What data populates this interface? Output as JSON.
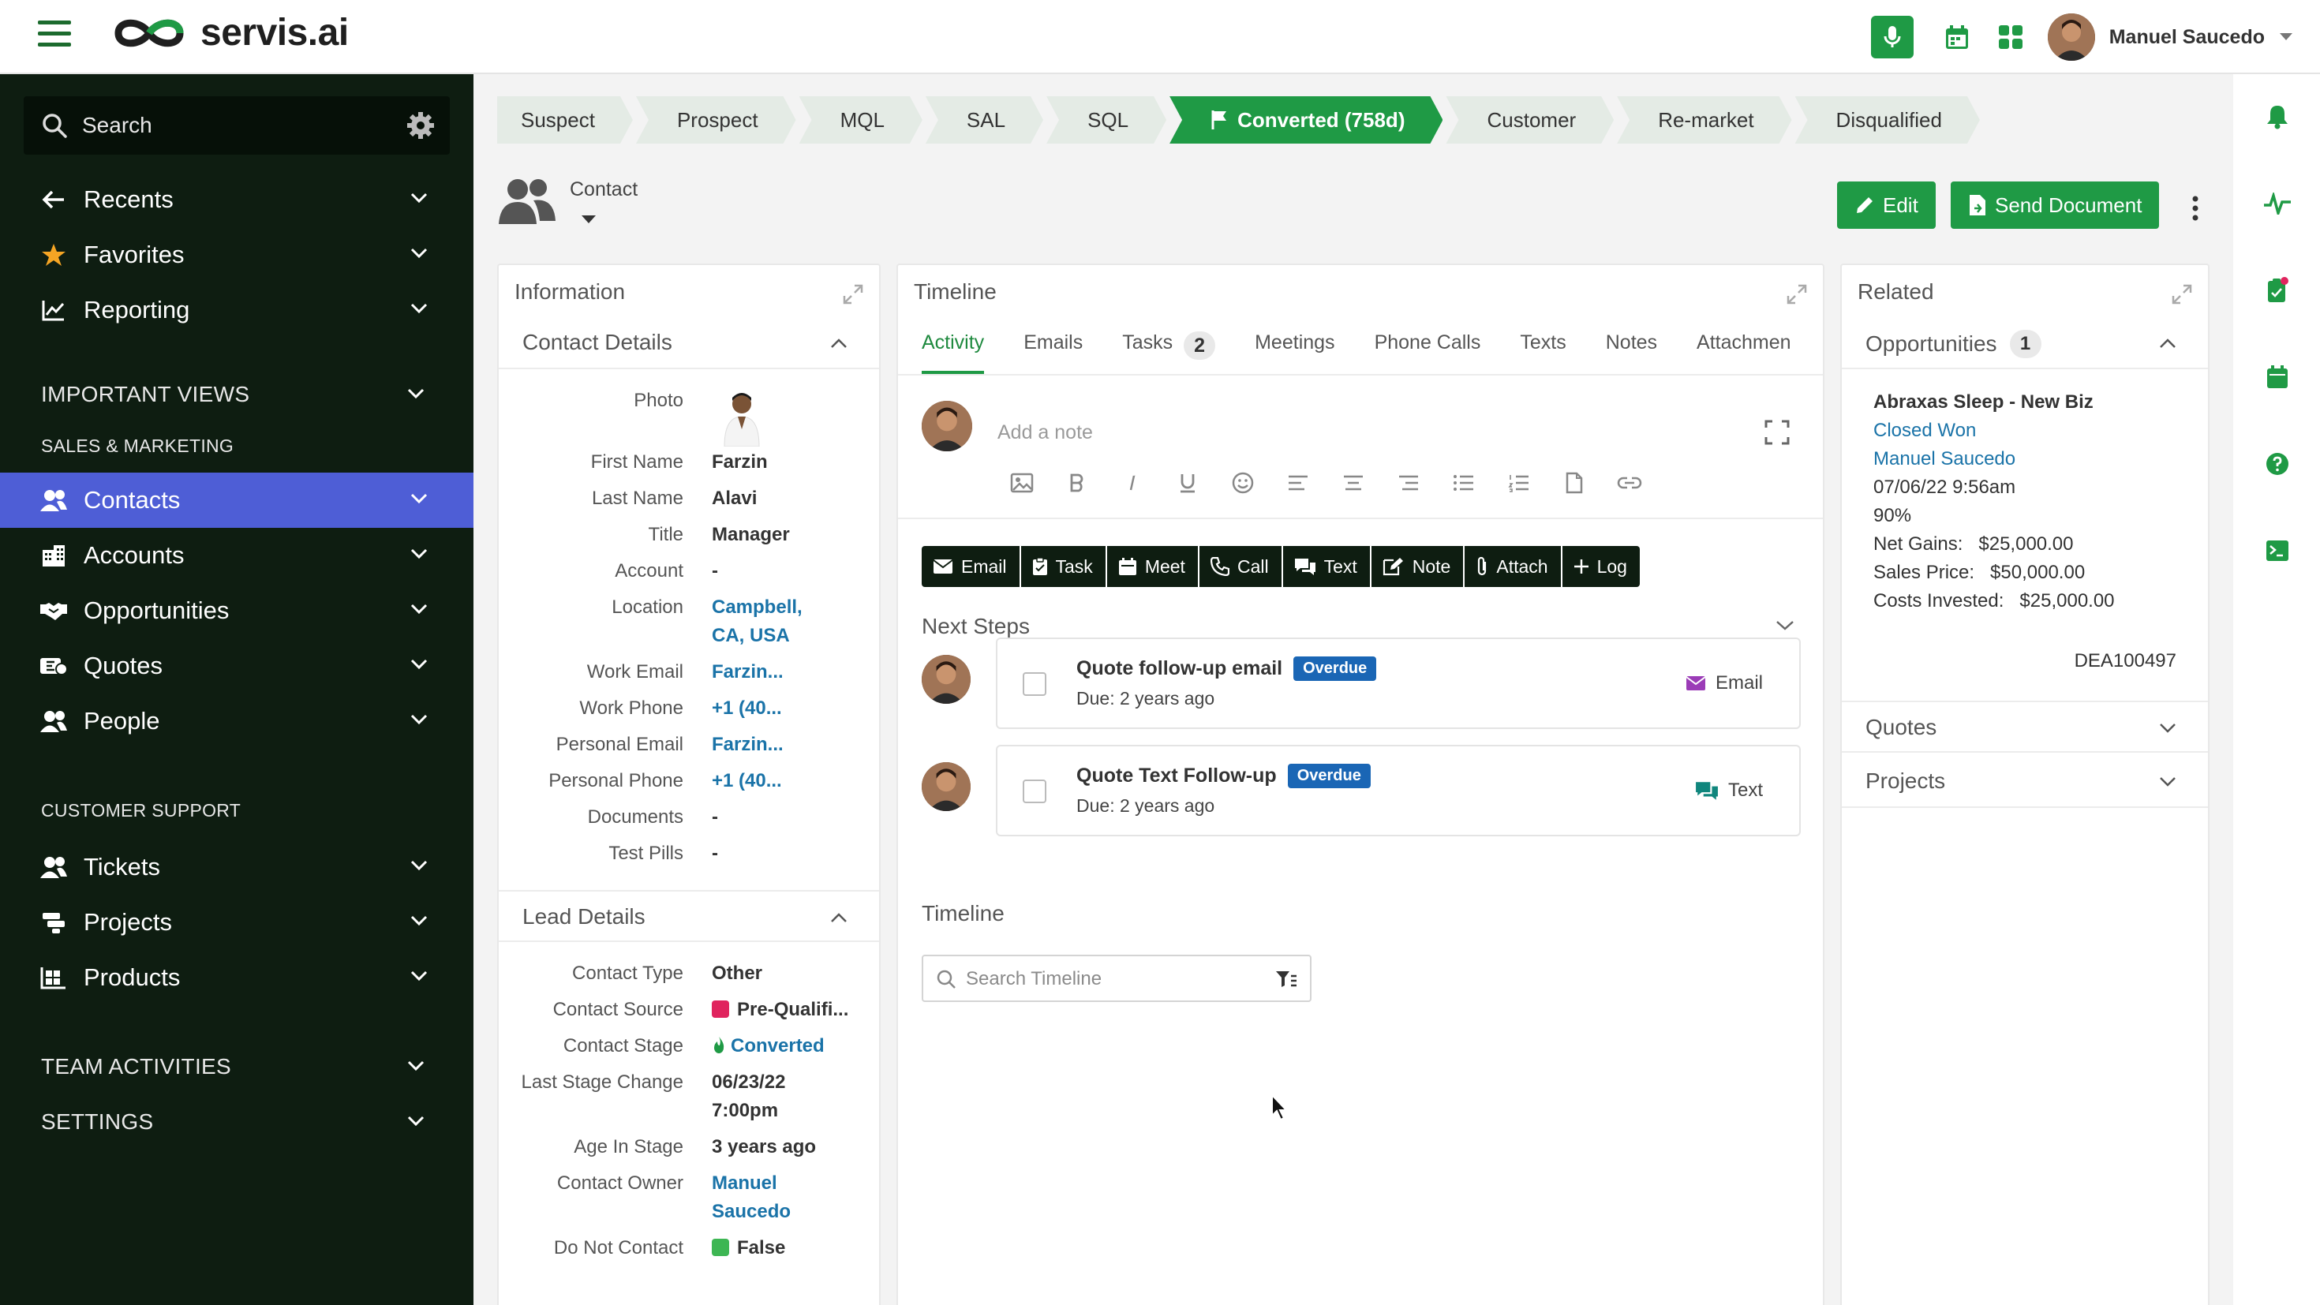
{
  "app": {
    "logo_text": "servis.ai",
    "user_name": "Manuel Saucedo"
  },
  "colors": {
    "brand_green": "#1f9a45",
    "sidebar_bg": "#0e1d11",
    "active_item": "#4e5ed6",
    "link": "#1a73a8",
    "overdue_badge": "#1a66b5"
  },
  "sidebar": {
    "search_label": "Search",
    "items": [
      {
        "label": "Recents",
        "icon": "arrow-left-icon"
      },
      {
        "label": "Favorites",
        "icon": "star-icon"
      },
      {
        "label": "Reporting",
        "icon": "chart-line-icon"
      }
    ],
    "section_important": "IMPORTANT VIEWS",
    "section_sales": "SALES & MARKETING",
    "sales_items": [
      {
        "label": "Contacts",
        "icon": "people-icon",
        "active": true
      },
      {
        "label": "Accounts",
        "icon": "building-icon"
      },
      {
        "label": "Opportunities",
        "icon": "handshake-icon"
      },
      {
        "label": "Quotes",
        "icon": "dollar-ticket-icon"
      },
      {
        "label": "People",
        "icon": "people-icon"
      }
    ],
    "section_support": "CUSTOMER SUPPORT",
    "support_items": [
      {
        "label": "Tickets",
        "icon": "people-icon"
      },
      {
        "label": "Projects",
        "icon": "projects-icon"
      },
      {
        "label": "Products",
        "icon": "products-icon"
      }
    ],
    "section_team": "TEAM ACTIVITIES",
    "section_settings": "SETTINGS"
  },
  "stages": [
    "Suspect",
    "Prospect",
    "MQL",
    "SAL",
    "SQL",
    "Converted (758d)",
    "Customer",
    "Re-market",
    "Disqualified"
  ],
  "active_stage": "Converted (758d)",
  "header": {
    "entity_label": "Contact",
    "edit_label": "Edit",
    "send_label": "Send Document"
  },
  "information": {
    "title": "Information",
    "contact_details_title": "Contact Details",
    "photo_label": "Photo",
    "contact_fields": [
      {
        "label": "First Name",
        "value": "Farzin"
      },
      {
        "label": "Last Name",
        "value": "Alavi"
      },
      {
        "label": "Title",
        "value": "Manager"
      },
      {
        "label": "Account",
        "value": "-"
      },
      {
        "label": "Location",
        "value": "Campbell,",
        "value2": "CA, USA"
      },
      {
        "label": "Work Email",
        "value": "Farzin..."
      },
      {
        "label": "Work Phone",
        "value": "+1 (40..."
      },
      {
        "label": "Personal Email",
        "value": "Farzin..."
      },
      {
        "label": "Personal Phone",
        "value": "+1 (40..."
      },
      {
        "label": "Documents",
        "value": "-"
      },
      {
        "label": "Test Pills",
        "value": "-"
      }
    ],
    "lead_details_title": "Lead Details",
    "lead_fields": [
      {
        "label": "Contact Type",
        "value": "Other"
      },
      {
        "label": "Contact Source",
        "value": "Pre-Qualifi..."
      },
      {
        "label": "Contact Stage",
        "value": "Converted"
      },
      {
        "label": "Last Stage Change",
        "value": "06/23/22",
        "value2": "7:00pm"
      },
      {
        "label": "Age In Stage",
        "value": "3 years ago"
      },
      {
        "label": "Contact Owner",
        "value": "Manuel",
        "value2": "Saucedo"
      },
      {
        "label": "Do Not Contact",
        "value": "False"
      }
    ]
  },
  "timeline": {
    "title": "Timeline",
    "tabs": [
      {
        "label": "Activity"
      },
      {
        "label": "Emails"
      },
      {
        "label": "Tasks",
        "badge": "2"
      },
      {
        "label": "Meetings"
      },
      {
        "label": "Phone Calls"
      },
      {
        "label": "Texts"
      },
      {
        "label": "Notes"
      },
      {
        "label": "Attachmen"
      }
    ],
    "note_placeholder": "Add a note",
    "actions": [
      "Email",
      "Task",
      "Meet",
      "Call",
      "Text",
      "Note",
      "Attach",
      "Log"
    ],
    "next_steps_title": "Next Steps",
    "steps": [
      {
        "title": "Quote follow-up email",
        "badge": "Overdue",
        "due": "Due: 2 years ago",
        "type": "Email"
      },
      {
        "title": "Quote Text Follow-up",
        "badge": "Overdue",
        "due": "Due: 2 years ago",
        "type": "Text"
      }
    ],
    "timeline_section_title": "Timeline",
    "search_placeholder": "Search Timeline"
  },
  "related": {
    "title": "Related",
    "opportunities_label": "Opportunities",
    "opportunities_count": "1",
    "opportunity": {
      "name": "Abraxas Sleep - New Biz",
      "status": "Closed Won",
      "owner": "Manuel Saucedo",
      "date": "07/06/22 9:56am",
      "probability": "90%",
      "net_gains": "Net Gains:   $25,000.00",
      "sales_price": "Sales Price:   $50,000.00",
      "costs_invested": "Costs Invested:   $25,000.00",
      "id": "DEA100497"
    },
    "quotes_label": "Quotes",
    "projects_label": "Projects"
  }
}
